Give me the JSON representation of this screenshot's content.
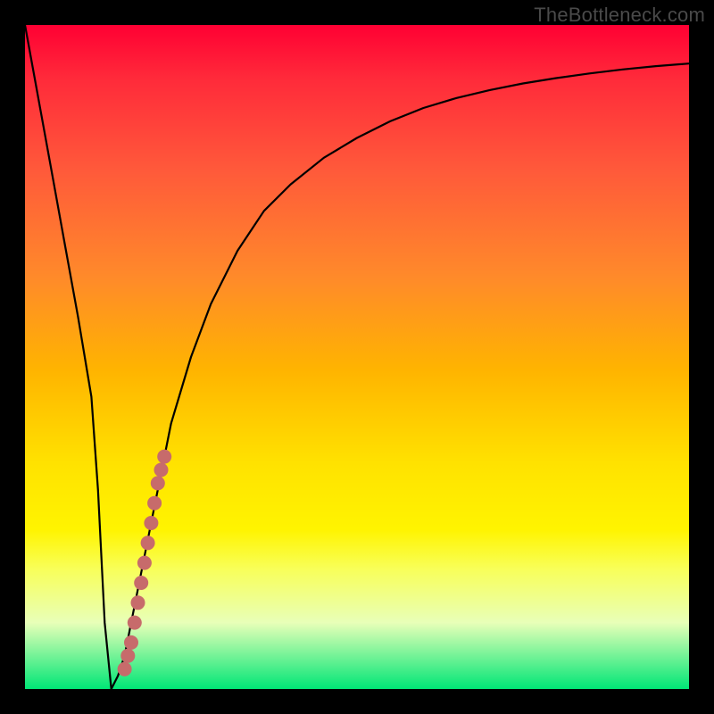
{
  "watermark": "TheBottleneck.com",
  "colors": {
    "background": "#000000",
    "curve": "#000000",
    "marker": "#c76b6b",
    "gradient_top": "#ff0033",
    "gradient_bottom": "#00e676"
  },
  "chart_data": {
    "type": "line",
    "title": "",
    "xlabel": "",
    "ylabel": "",
    "xlim": [
      0,
      100
    ],
    "ylim": [
      0,
      100
    ],
    "grid": false,
    "legend": false,
    "series": [
      {
        "name": "bottleneck-curve",
        "x": [
          0,
          2,
          4,
          6,
          8,
          10,
          11,
          12,
          13,
          14,
          15,
          16,
          18,
          20,
          22,
          25,
          28,
          32,
          36,
          40,
          45,
          50,
          55,
          60,
          65,
          70,
          75,
          80,
          85,
          90,
          95,
          100
        ],
        "y": [
          100,
          89,
          78,
          67,
          56,
          44,
          30,
          10,
          0,
          2,
          5,
          10,
          20,
          30,
          40,
          50,
          58,
          66,
          72,
          76,
          80,
          83,
          85.5,
          87.5,
          89,
          90.2,
          91.2,
          92,
          92.7,
          93.3,
          93.8,
          94.2
        ]
      },
      {
        "name": "highlight-markers",
        "x": [
          15,
          15.5,
          16,
          16.5,
          17,
          17.5,
          18,
          18.5,
          19,
          19.5,
          20,
          20.5,
          21
        ],
        "y": [
          3,
          5,
          7,
          10,
          13,
          16,
          19,
          22,
          25,
          28,
          31,
          33,
          35
        ]
      }
    ]
  }
}
